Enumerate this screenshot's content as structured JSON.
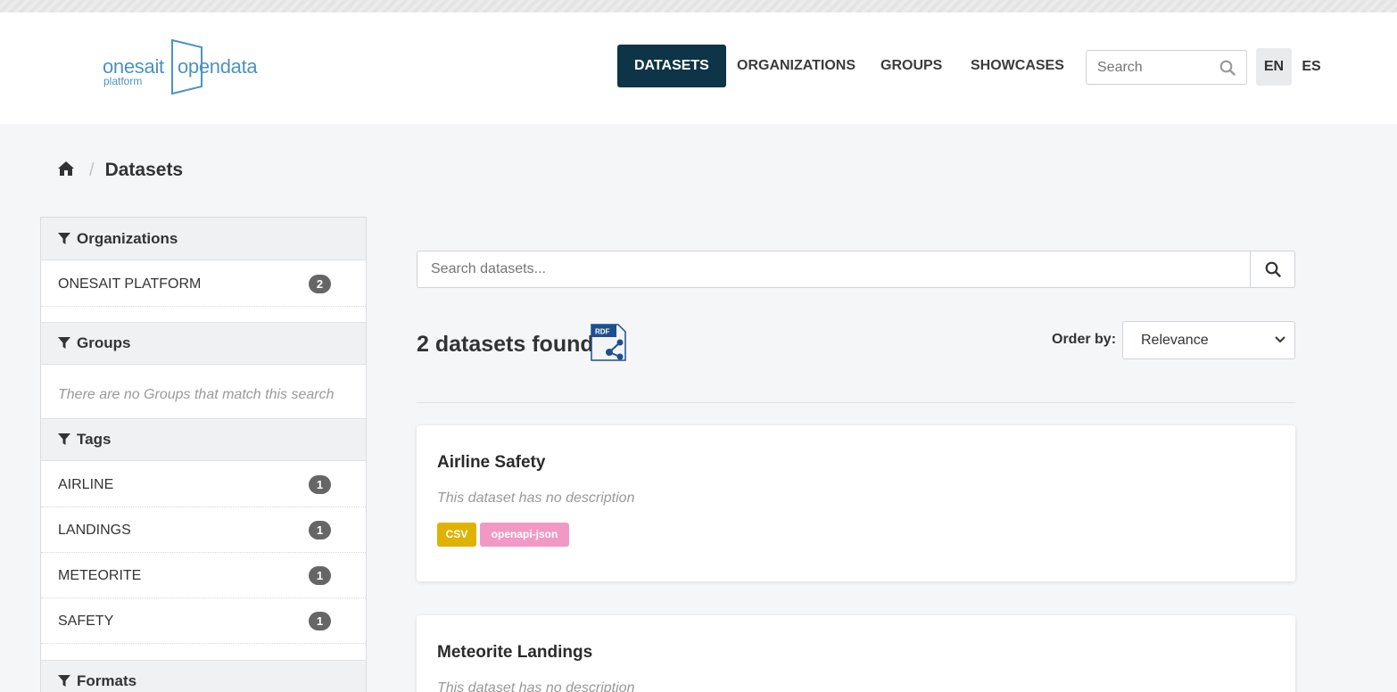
{
  "header": {
    "logo": {
      "word1": "onesait",
      "word2": "opendata",
      "word3": "platform"
    },
    "nav": [
      {
        "label": "DATASETS",
        "active": true
      },
      {
        "label": "ORGANIZATIONS",
        "active": false
      },
      {
        "label": "GROUPS",
        "active": false
      },
      {
        "label": "SHOWCASES",
        "active": false
      }
    ],
    "search_placeholder": "Search",
    "languages": [
      {
        "label": "EN",
        "active": true
      },
      {
        "label": "ES",
        "active": false
      }
    ]
  },
  "breadcrumb": {
    "home_icon": "home-icon",
    "current": "Datasets"
  },
  "sidebar": {
    "organizations": {
      "title": "Organizations",
      "items": [
        {
          "label": "ONESAIT PLATFORM",
          "count": "2"
        }
      ]
    },
    "groups": {
      "title": "Groups",
      "empty_text": "There are no Groups that match this search"
    },
    "tags": {
      "title": "Tags",
      "items": [
        {
          "label": "AIRLINE",
          "count": "1"
        },
        {
          "label": "LANDINGS",
          "count": "1"
        },
        {
          "label": "METEORITE",
          "count": "1"
        },
        {
          "label": "SAFETY",
          "count": "1"
        }
      ]
    },
    "formats": {
      "title": "Formats"
    }
  },
  "main": {
    "search_placeholder": "Search datasets...",
    "found_text": "2 datasets found",
    "rdf_label": "RDF",
    "order_by_label": "Order by:",
    "order_by_value": "Relevance",
    "datasets": [
      {
        "title": "Airline Safety",
        "description": "This dataset has no description",
        "formats": [
          {
            "label": "CSV",
            "color": "#dfb200"
          },
          {
            "label": "openapi-json",
            "color": "#f199c4"
          }
        ]
      },
      {
        "title": "Meteorite Landings",
        "description": "This dataset has no description",
        "formats": []
      }
    ]
  },
  "colors": {
    "nav_active_bg": "#0d3447",
    "logo": "#4a93c0",
    "badge": "#666666"
  }
}
